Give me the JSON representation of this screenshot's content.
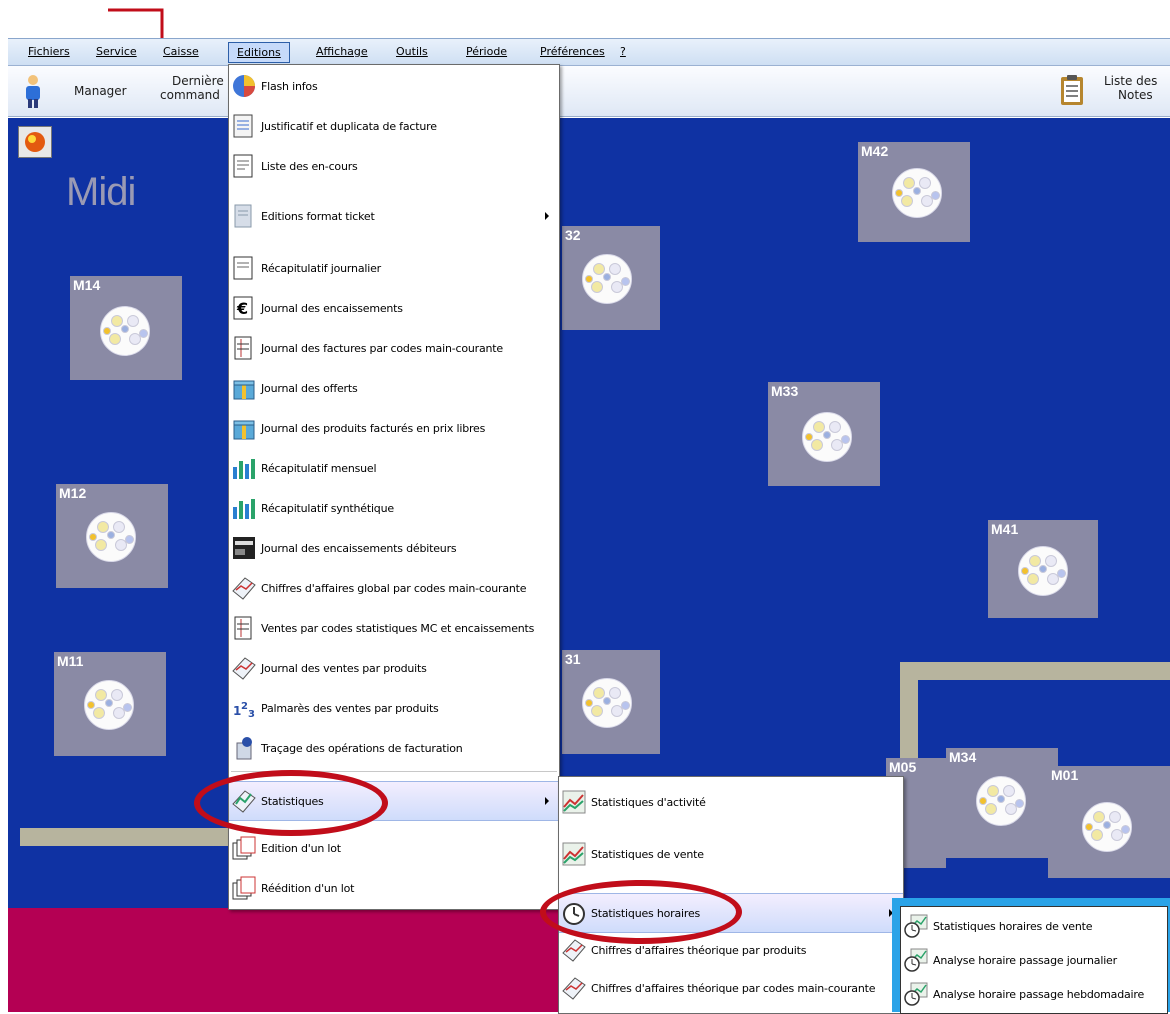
{
  "menubar": {
    "items": [
      "Fichiers",
      "Service",
      "Caisse",
      "Editions",
      "Affichage",
      "Outils",
      "Période",
      "Préférences",
      "?"
    ]
  },
  "toolbar": {
    "manager": "Manager",
    "derniere_1": "Dernière",
    "derniere_2": "command",
    "liste_1": "Liste des",
    "liste_2": "Notes"
  },
  "floor": {
    "service_title": "Midi",
    "tables": {
      "m14": "M14",
      "m12": "M12",
      "m11": "M11",
      "m32": "32",
      "m31": "31",
      "m33": "M33",
      "m42": "M42",
      "m41": "M41",
      "m05": "M05",
      "m34": "M34",
      "m01": "M01"
    }
  },
  "editions_menu": {
    "items": [
      "Flash infos",
      "Justificatif et duplicata de facture",
      "Liste des en-cours",
      "Editions format ticket",
      "Récapitulatif journalier",
      "Journal des encaissements",
      "Journal des factures par codes main-courante",
      "Journal des offerts",
      "Journal des produits facturés en prix libres",
      "Récapitulatif mensuel",
      "Récapitulatif synthétique",
      "Journal des encaissements débiteurs",
      "Chiffres d'affaires global par codes main-courante",
      "Ventes par codes statistiques MC et encaissements",
      "Journal des ventes par produits",
      "Palmarès des ventes par produits",
      "Traçage des opérations de facturation",
      "Statistiques",
      "Edition d'un lot",
      "Réédition d'un lot"
    ]
  },
  "statistiques_menu": {
    "items": [
      "Statistiques d'activité",
      "Statistiques de vente",
      "Statistiques horaires",
      "Chiffres d'affaires théorique par produits",
      "Chiffres d'affaires théorique par codes main-courante"
    ]
  },
  "horaires_menu": {
    "items": [
      "Statistiques horaires de vente",
      "Analyse horaire passage journalier",
      "Analyse horaire passage hebdomadaire"
    ]
  },
  "colors": {
    "floor_blue": "#0f32a3",
    "table_grey": "#8a8aa5",
    "annotation_red": "#c10d1a",
    "lower_band": "#b40053",
    "submenu_frame": "#2aa3e8"
  }
}
